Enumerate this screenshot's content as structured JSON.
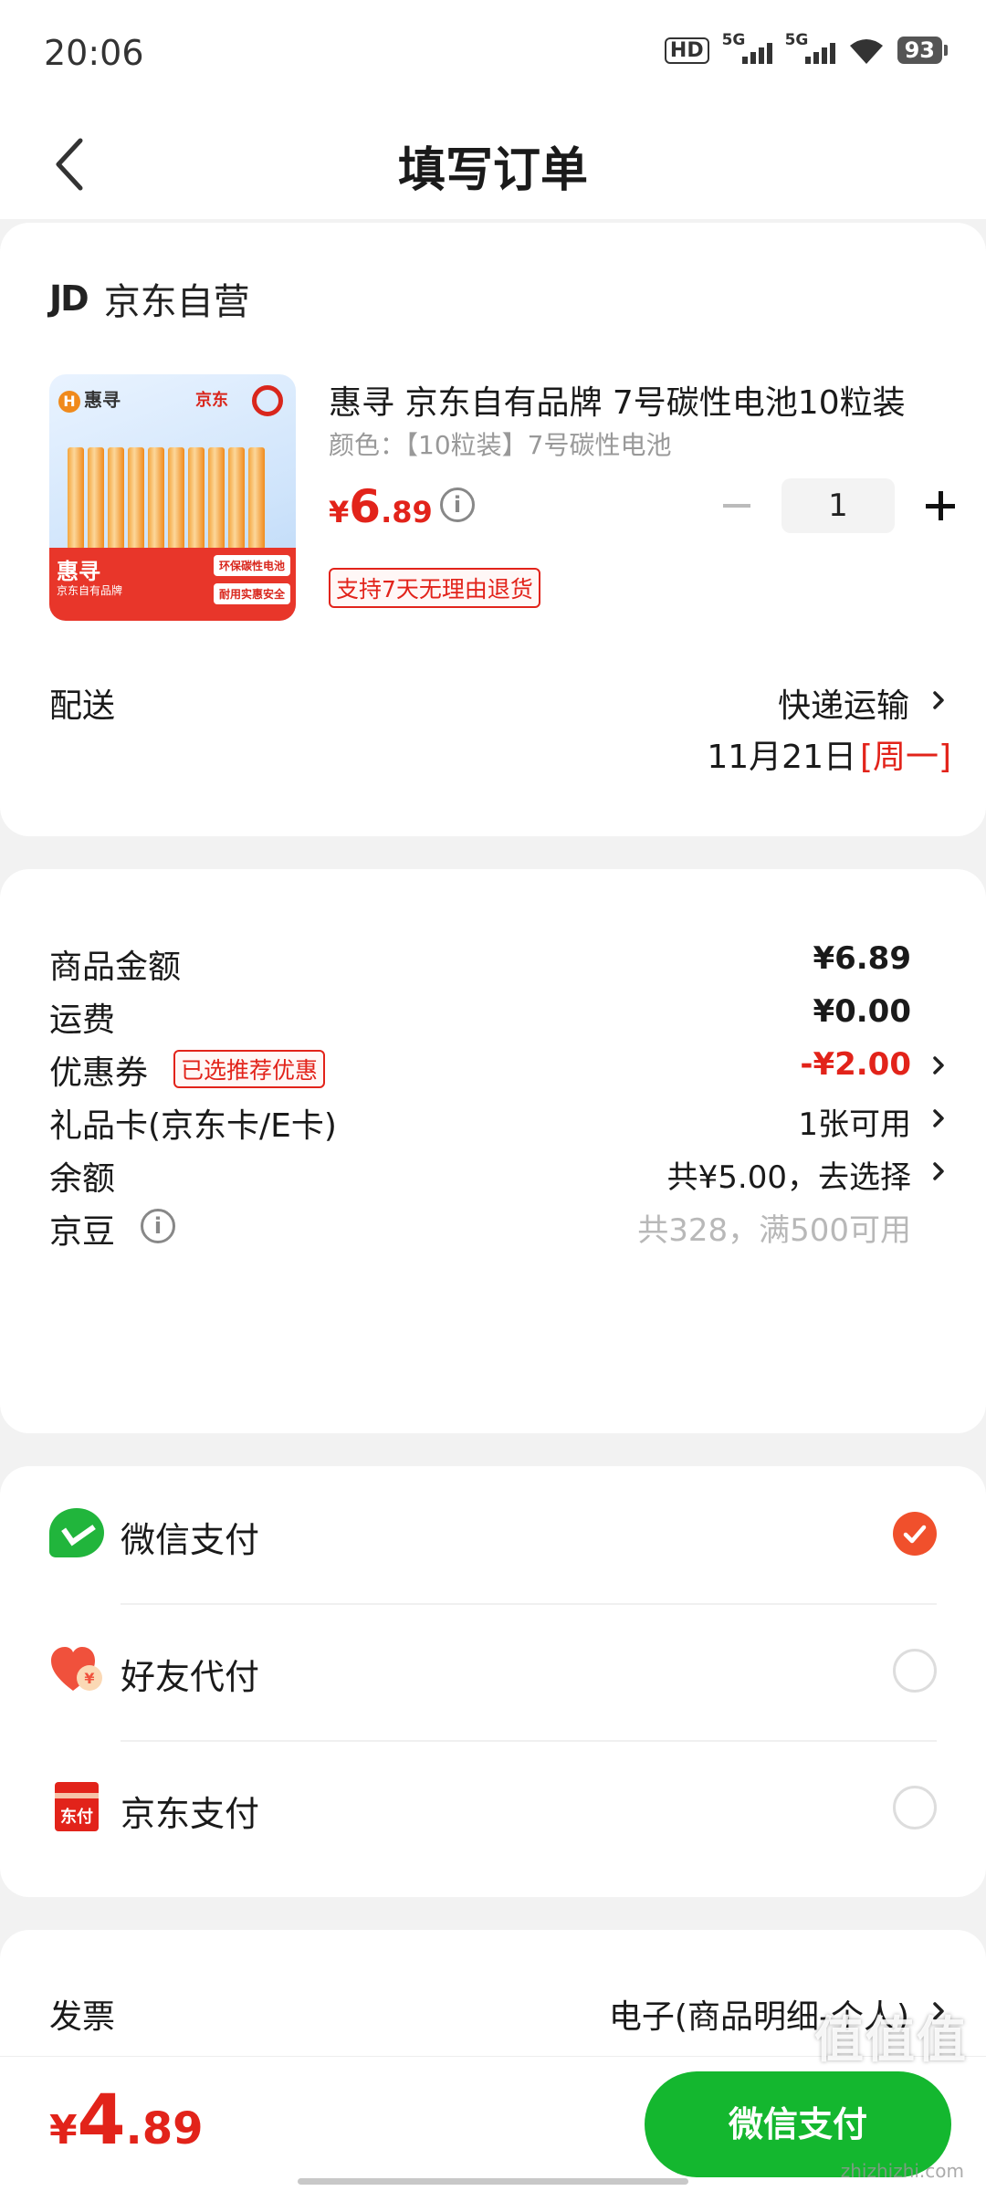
{
  "status_bar": {
    "time": "20:06",
    "hd": "HD",
    "sim1": "5G",
    "sim2": "5G",
    "battery": "93"
  },
  "nav": {
    "title": "填写订单"
  },
  "shop": {
    "logo": "JD",
    "name": "京东自营",
    "product": {
      "image_brand": "惠寻",
      "image_partner": "京东",
      "image_panel_title": "惠寻",
      "image_panel_sub": "京东自有品牌",
      "image_tag1": "环保碳性电池",
      "image_tag2": "耐用实惠安全",
      "title": "惠寻 京东自有品牌 7号碳性电池10粒装",
      "spec": "颜色：【10粒装】7号碳性电池",
      "price_symbol": "¥",
      "price_int": "6",
      "price_dec": ".89",
      "quantity": "1",
      "return_policy": "支持7天无理由退货"
    },
    "delivery": {
      "label": "配送",
      "method": "快递运输",
      "date": "11月21日",
      "weekday": "[周一]"
    }
  },
  "summary": {
    "rows": [
      {
        "label": "商品金额",
        "value": "¥6.89"
      },
      {
        "label": "运费",
        "value": "¥0.00"
      },
      {
        "label": "优惠券",
        "tag": "已选推荐优惠",
        "value": "-¥2.00"
      },
      {
        "label": "礼品卡(京东卡/E卡)",
        "value": "1张可用"
      },
      {
        "label": "余额",
        "value": "共¥5.00，去选择"
      },
      {
        "label": "京豆",
        "value": "共328，满500可用"
      }
    ]
  },
  "payment": {
    "methods": [
      {
        "label": "微信支付",
        "icon": "wechat-icon",
        "selected": true
      },
      {
        "label": "好友代付",
        "icon": "heart-yuan-icon",
        "selected": false
      },
      {
        "label": "京东支付",
        "icon": "jd-pay-icon",
        "icon_text": "东付",
        "selected": false
      }
    ]
  },
  "invoice": {
    "label": "发票",
    "value": "电子(商品明细-个人)"
  },
  "footer": {
    "total_symbol": "¥",
    "total_int": "4",
    "total_dec": ".89",
    "pay_button": "微信支付",
    "watermark": "值值值",
    "watermark_sub": "zhizhizhi.com"
  },
  "colors": {
    "accent_red": "#e2231a",
    "wechat_green": "#14b72f",
    "radio_orange": "#f0502c"
  }
}
